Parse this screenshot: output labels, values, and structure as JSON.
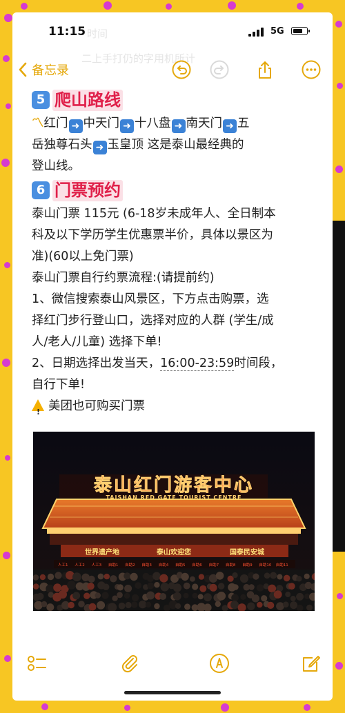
{
  "status_bar": {
    "time": "11:15",
    "network": "5G"
  },
  "nav": {
    "back_label": "备忘录"
  },
  "sections": [
    {
      "number": "5",
      "title": "爬山路线"
    },
    {
      "number": "6",
      "title": "门票预约"
    }
  ],
  "route": {
    "stops": [
      "红门",
      "中天门",
      "十八盘",
      "南天门",
      "五岳独尊石头",
      "玉皇顶"
    ],
    "tail": " 这是泰山最经典的登山线。",
    "line1": "红门",
    "line2": "中天门",
    "line3": "十八盘",
    "line4": "南天门",
    "line5a": "五",
    "line5b": "岳独尊石头",
    "line6": "玉皇顶",
    "line7": "  这是泰山最经典的",
    "line8": "登山线。"
  },
  "ticket": {
    "p1_l1": "泰山门票 115元 (6-18岁未成年人、全日制本",
    "p1_l2": "科及以下学历学生优惠票半价，具体以景区为",
    "p1_l3": "准)(60以上免门票)",
    "p2": "泰山门票自行约票流程:(请提前约)",
    "p3_l1": "1、微信搜索泰山风景区，下方点击购票，选",
    "p3_l2": "择红门步行登山口，选择对应的人群 (学生/成",
    "p3_l3": "人/老人/儿童) 选择下单!",
    "p4_l1a": "2、日期选择出发当天，",
    "p4_time": "16:00-23:59",
    "p4_l1b": "时间段，",
    "p4_l2": "自行下单!",
    "p5": "美团也可购买门票"
  },
  "photo": {
    "sign_cn": "泰山红门游客中心",
    "sign_en": "TAISHAN RED GATE TOURIST CENTRE",
    "banner_left": "世界遗产地",
    "banner_mid": "泰山欢迎您",
    "banner_right": "国泰民安城",
    "lanes": [
      "人工1",
      "人工2",
      "人工3",
      "自助1",
      "自助2",
      "自助3",
      "自助4",
      "自助5",
      "自助6",
      "自助7",
      "自助8",
      "自助9",
      "自助10",
      "自助11"
    ]
  },
  "ghost_text": {
    "top": "二上手打仍的字用机所计",
    "left": "时间"
  },
  "colors": {
    "accent": "#e5a80b",
    "heading": "#e0204a",
    "background": "#f7c623"
  },
  "icons": [
    "undo-icon",
    "redo-icon",
    "share-icon",
    "more-icon",
    "checklist-icon",
    "attachment-icon",
    "markup-icon",
    "compose-icon"
  ]
}
